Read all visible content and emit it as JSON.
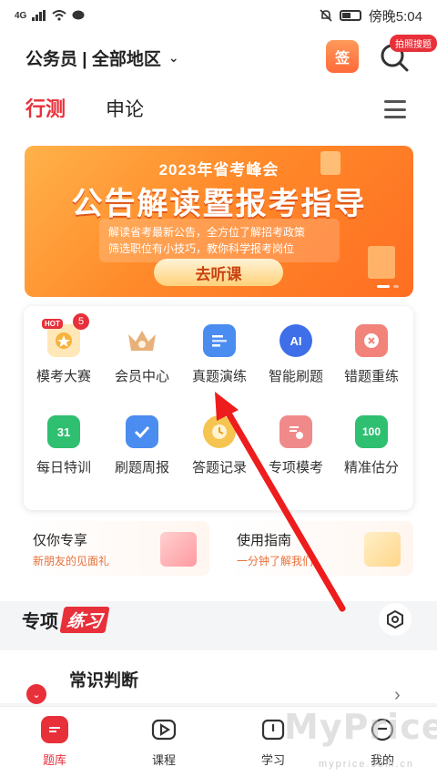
{
  "status_bar": {
    "network": "4G",
    "time_label": "傍晚5:04"
  },
  "header": {
    "region_label": "公务员 | 全部地区",
    "sign_label": "签",
    "search_badge": "拍照搜题"
  },
  "tabs": [
    {
      "label": "行测",
      "active": true
    },
    {
      "label": "申论",
      "active": false
    }
  ],
  "banner": {
    "top_text": "2023年省考峰会",
    "title": "公告解读暨报考指导",
    "line1": "解读省考最新公告，全方位了解招考政策",
    "line2": "筛选职位有小技巧，教你科学报考岗位",
    "button": "去听课"
  },
  "grid": [
    {
      "label": "模考大赛",
      "icon": "trophy-icon",
      "hot": "HOT",
      "badge": "5"
    },
    {
      "label": "会员中心",
      "icon": "crown-icon"
    },
    {
      "label": "真题演练",
      "icon": "document-icon"
    },
    {
      "label": "智能刷题",
      "icon": "ai-icon",
      "icon_text": "AI"
    },
    {
      "label": "错题重练",
      "icon": "error-icon"
    },
    {
      "label": "每日特训",
      "icon": "calendar-icon",
      "icon_text": "31"
    },
    {
      "label": "刷题周报",
      "icon": "clipboard-icon"
    },
    {
      "label": "答题记录",
      "icon": "clock-icon"
    },
    {
      "label": "专项模考",
      "icon": "certificate-icon"
    },
    {
      "label": "精准估分",
      "icon": "score-icon",
      "icon_text": "100"
    }
  ],
  "promos": [
    {
      "title": "仅你专享",
      "subtitle": "新朋友的见面礼"
    },
    {
      "title": "使用指南",
      "subtitle": "一分钟了解我们"
    }
  ],
  "section": {
    "title_a": "专项",
    "title_b": "练习"
  },
  "practice_row": {
    "title": "常识判断"
  },
  "tabbar": [
    {
      "label": "题库",
      "icon": "question-bank-icon",
      "active": true
    },
    {
      "label": "课程",
      "icon": "play-icon",
      "active": false
    },
    {
      "label": "学习",
      "icon": "book-icon",
      "active": false
    },
    {
      "label": "我的",
      "icon": "profile-icon",
      "active": false
    }
  ],
  "watermark": {
    "text": "MyPrice",
    "sub": "myprice.com.cn"
  },
  "colors": {
    "accent": "#e8303a",
    "banner": "#ff8a2a"
  }
}
